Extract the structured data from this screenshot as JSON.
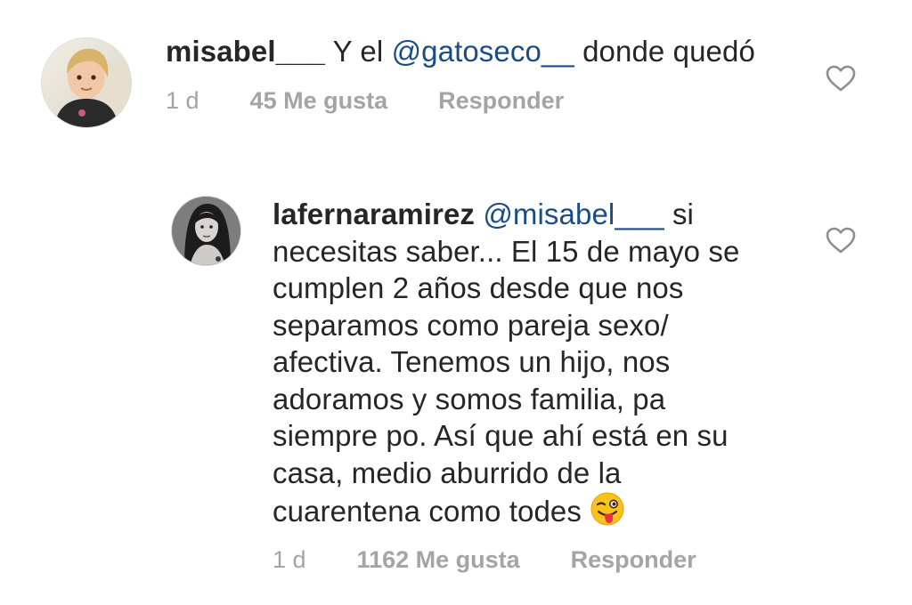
{
  "comments": [
    {
      "username": "misabel___",
      "text_before": " Y el ",
      "mention": "@gatoseco__",
      "text_after": " donde quedó",
      "time": "1 d",
      "likes": "45 Me gusta",
      "reply": "Responder"
    },
    {
      "username": "lafernaramirez",
      "mention": "@misabel___",
      "text_after": " si necesitas saber... El 15 de mayo se cumplen 2 años desde que nos separamos como pareja sexo/ afectiva. Tenemos un hijo, nos adoramos y somos familia, pa siempre po. Así que ahí está en su casa, medio aburrido de la cuarentena como todes ",
      "emoji_icon": "winking-face-with-tongue-icon",
      "time": "1 d",
      "likes": "1162 Me gusta",
      "reply": "Responder"
    }
  ],
  "colors": {
    "mention": "#1b4c8a",
    "meta": "#a4a4a4",
    "text": "#262626"
  }
}
